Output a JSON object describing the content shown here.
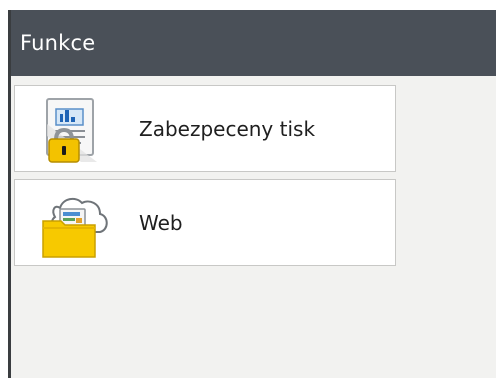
{
  "header": {
    "title": "Funkce"
  },
  "menu": {
    "items": [
      {
        "label": "Zabezpeceny tisk",
        "icon": "secure-print-icon"
      },
      {
        "label": "Web",
        "icon": "web-folder-icon"
      }
    ]
  },
  "colors": {
    "header_background": "#4a5058",
    "content_background": "#f2f2f0",
    "item_background": "#ffffff",
    "item_border": "#c8c8c6",
    "lock_yellow": "#f3c200",
    "folder_yellow": "#f7c900"
  }
}
